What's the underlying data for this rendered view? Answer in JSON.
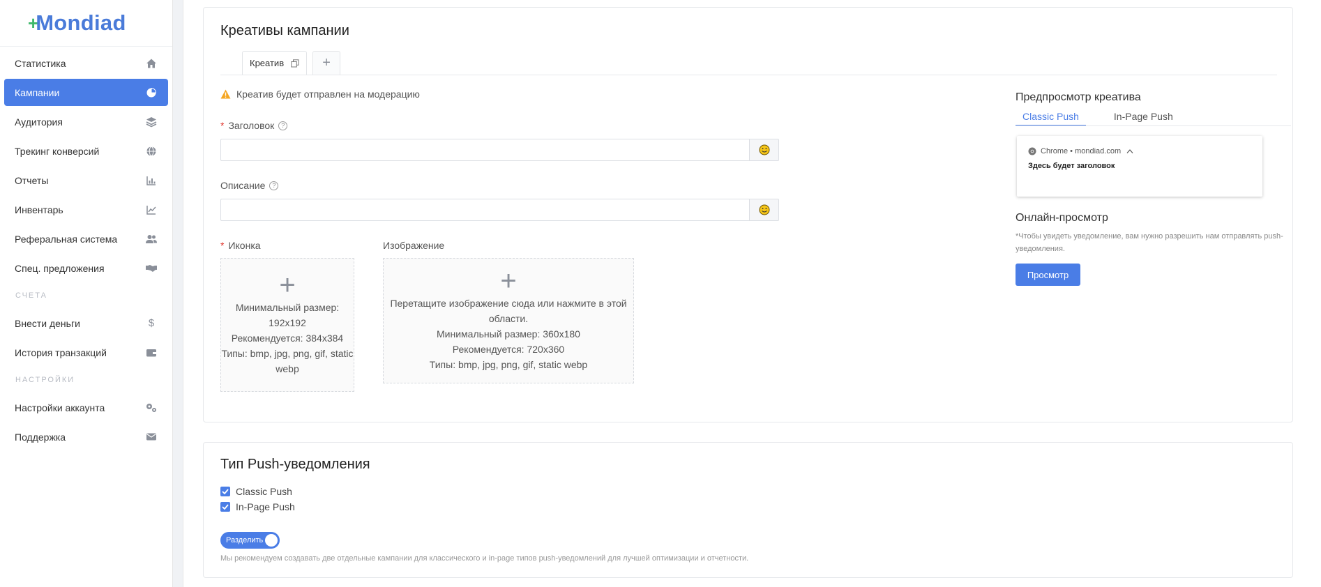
{
  "brand": {
    "logo": "Mondiad"
  },
  "sidebar": {
    "items": [
      {
        "label": "Статистика",
        "icon": "home-icon"
      },
      {
        "label": "Кампании",
        "icon": "pie-chart-icon",
        "active": true
      },
      {
        "label": "Аудитория",
        "icon": "layers-icon"
      },
      {
        "label": "Трекинг конверсий",
        "icon": "globe-icon"
      },
      {
        "label": "Отчеты",
        "icon": "bar-chart-icon"
      },
      {
        "label": "Инвентарь",
        "icon": "line-chart-icon"
      },
      {
        "label": "Реферальная система",
        "icon": "users-icon"
      },
      {
        "label": "Спец. предложения",
        "icon": "handshake-icon"
      }
    ],
    "section_accounts": "СЧЕТА",
    "accounts": [
      {
        "label": "Внести деньги",
        "icon": "dollar-icon"
      },
      {
        "label": "История транзакций",
        "icon": "wallet-icon"
      }
    ],
    "section_settings": "НАСТРОЙКИ",
    "settings": [
      {
        "label": "Настройки аккаунта",
        "icon": "gears-icon"
      },
      {
        "label": "Поддержка",
        "icon": "envelope-icon"
      }
    ]
  },
  "creatives": {
    "title": "Креативы кампании",
    "tab_label": "Креатив",
    "add_tab": "+",
    "warning": "Креатив будет отправлен на модерацию",
    "headline_label": "Заголовок",
    "description_label": "Описание",
    "headline_value": "",
    "description_value": "",
    "icon_label": "Иконка",
    "image_label": "Изображение",
    "icon_dropzone": {
      "line1": "Минимальный размер:",
      "line2": "192x192",
      "line3": "Рекомендуется: 384x384",
      "line4": "Типы: bmp, jpg, png, gif, static",
      "line5": "webp"
    },
    "image_dropzone": {
      "line1": "Перетащите изображение сюда или нажмите в этой",
      "line2": "области.",
      "line3": "Минимальный размер: 360x180",
      "line4": "Рекомендуется: 720x360",
      "line5": "Типы: bmp, jpg, png, gif, static webp"
    }
  },
  "preview": {
    "title": "Предпросмотр креатива",
    "tabs": [
      "Classic Push",
      "In-Page Push"
    ],
    "active_tab": "Classic Push",
    "notification_source": "Chrome • mondiad.com",
    "notification_title": "Здесь будет заголовок",
    "online_title": "Онлайн-просмотр",
    "online_note": "*Чтобы увидеть уведомление, вам нужно разрешить нам отправлять push-уведомления.",
    "preview_button": "Просмотр"
  },
  "push_type": {
    "title": "Тип Push-уведомления",
    "options": [
      {
        "label": "Classic Push",
        "checked": true
      },
      {
        "label": "In-Page Push",
        "checked": true
      }
    ],
    "toggle_label": "Разделить",
    "toggle_on": true,
    "note": "Мы рекомендуем создавать две отдельные кампании для классического и in-page типов push-уведомлений для лучшей оптимизации и отчетности."
  },
  "colors": {
    "accent": "#4a7de6",
    "logo_green": "#3fb86b",
    "required": "#e0342b",
    "warning": "#f5a623"
  }
}
